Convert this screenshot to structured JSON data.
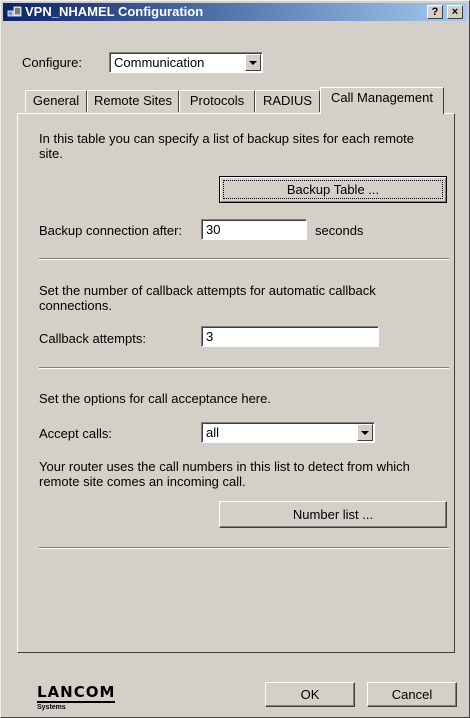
{
  "window": {
    "title": "VPN_NHAMEL Configuration",
    "help_label": "?",
    "close_label": "×"
  },
  "configure": {
    "label": "Configure:",
    "selected": "Communication"
  },
  "tabs": [
    {
      "label": "General"
    },
    {
      "label": "Remote Sites"
    },
    {
      "label": "Protocols"
    },
    {
      "label": "RADIUS"
    },
    {
      "label": "Call Management",
      "active": true
    }
  ],
  "backup": {
    "description": "In this table you can specify a list of backup sites for each remote site.",
    "button_label": "Backup Table ...",
    "connection_label": "Backup connection after:",
    "connection_value": "30",
    "unit": "seconds"
  },
  "callback": {
    "description": "Set the number of callback attempts for automatic callback connections.",
    "attempts_label": "Callback attempts:",
    "attempts_value": "3"
  },
  "acceptance": {
    "description": "Set the options for call acceptance here.",
    "accept_label": "Accept calls:",
    "accept_value": "all",
    "numbers_description": "Your router uses the call numbers in this list to detect from which remote site comes an incoming call.",
    "number_list_label": "Number list ..."
  },
  "footer": {
    "logo": "LANCOM",
    "logo_sub": "Systems",
    "ok_label": "OK",
    "cancel_label": "Cancel"
  },
  "colors": {
    "titlebar_start": "#0a246a",
    "titlebar_end": "#a6caf0",
    "dialog_bg": "#d4d0c8"
  }
}
